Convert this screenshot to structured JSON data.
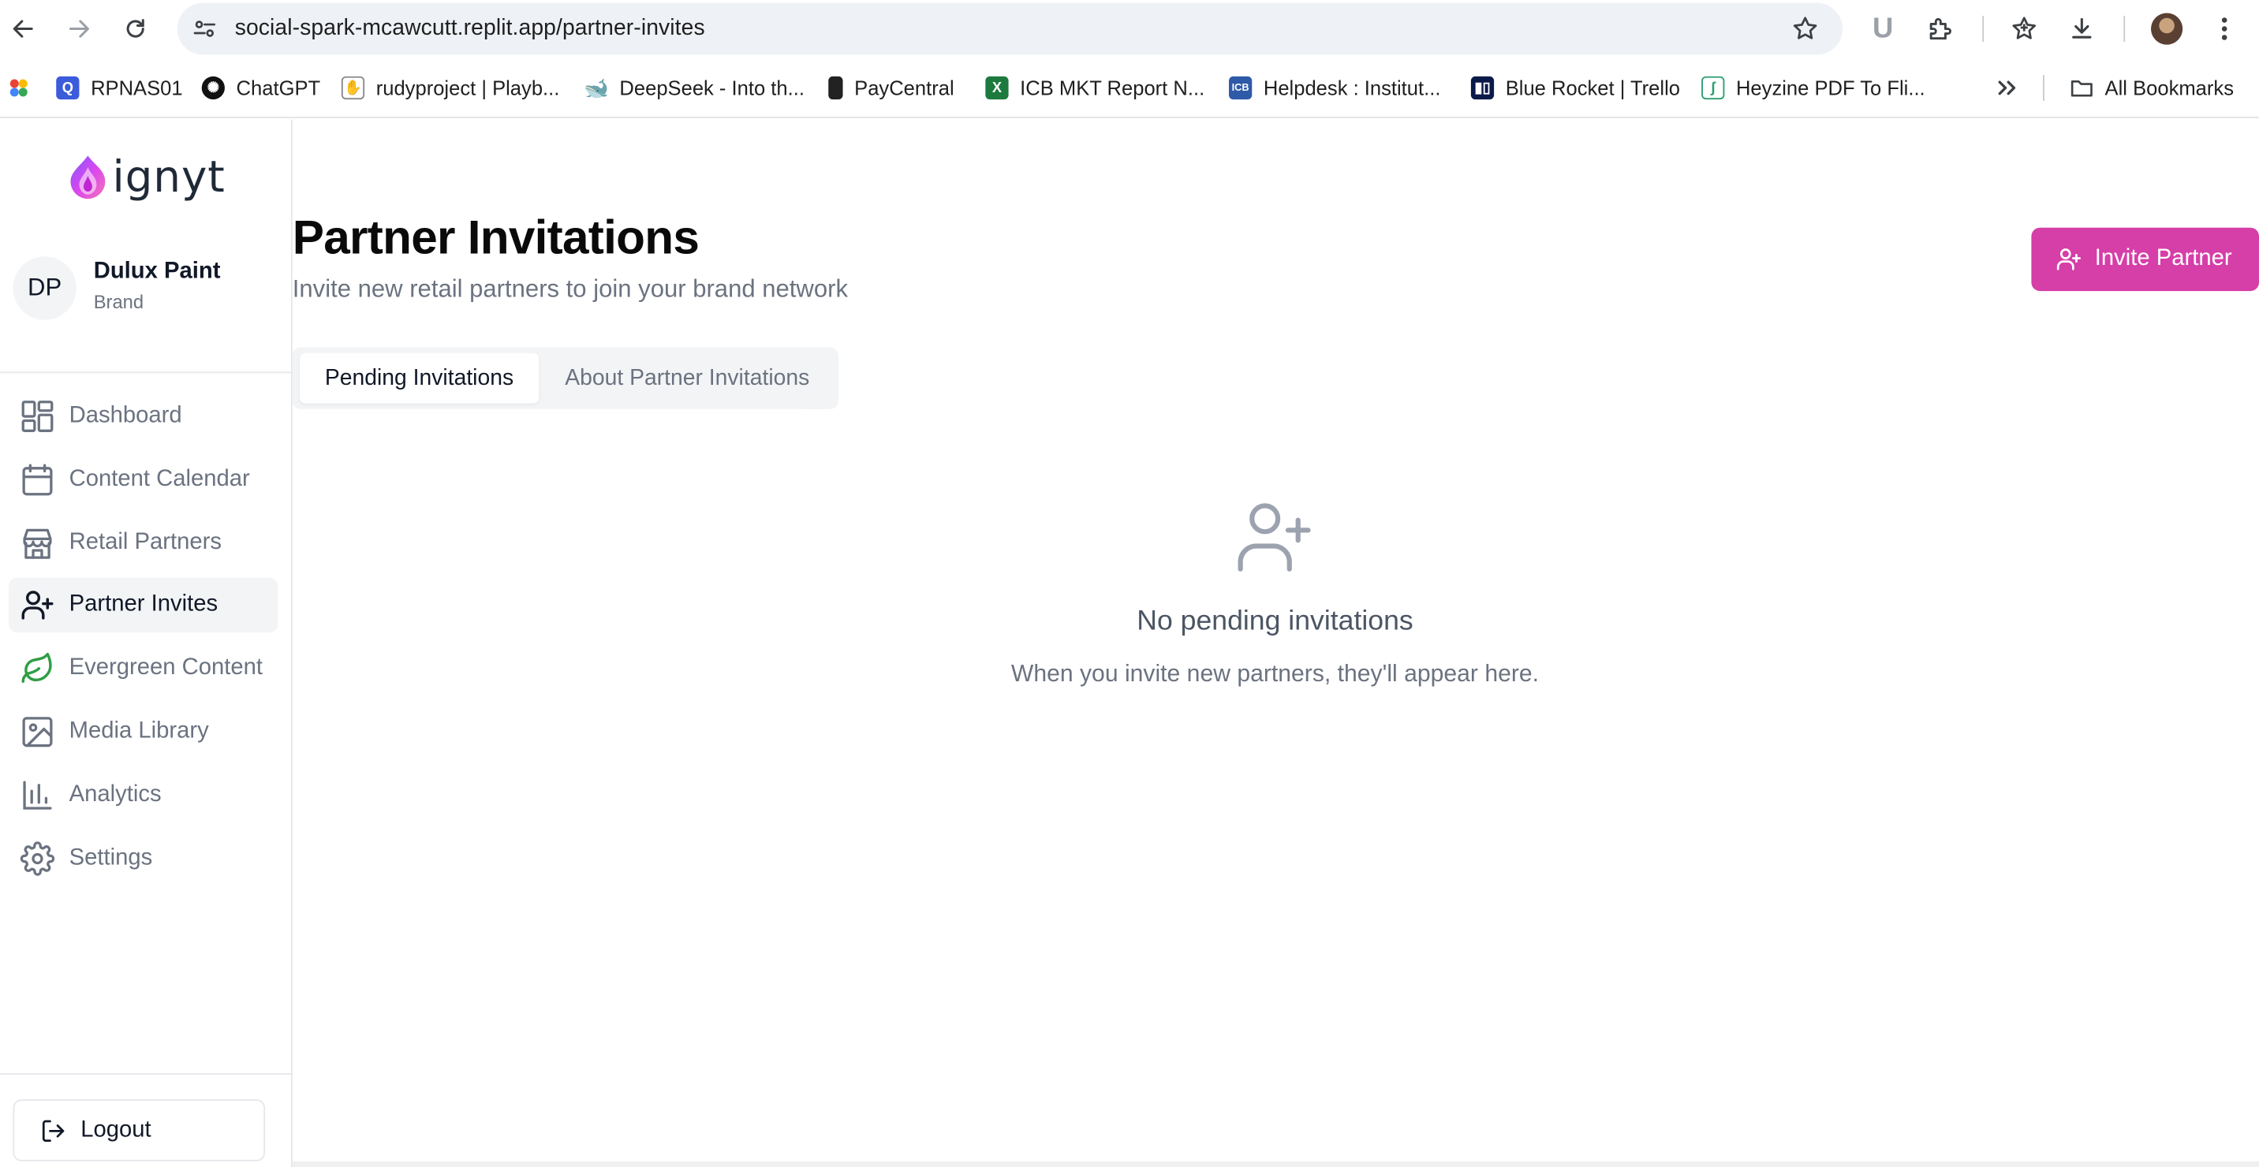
{
  "browser": {
    "url_host": "social-spark-mcawcutt.replit.app",
    "url_path": "/partner-invites"
  },
  "bookmarks": [
    {
      "label": "RPNAS01",
      "color": "#3b5bdb"
    },
    {
      "label": "ChatGPT",
      "color": "#111111"
    },
    {
      "label": "rudyproject | Playb...",
      "color": "#555555"
    },
    {
      "label": "DeepSeek - Into th...",
      "color": "#4d6bfe"
    },
    {
      "label": "PayCentral",
      "color": "#222222"
    },
    {
      "label": "ICB MKT Report N...",
      "color": "#1d7a3e"
    },
    {
      "label": "Helpdesk : Institut...",
      "color": "#2e5aa8"
    },
    {
      "label": "Blue Rocket | Trello",
      "color": "#0c1a4a"
    },
    {
      "label": "Heyzine PDF To Fli...",
      "color": "#2a9d6e"
    }
  ],
  "all_bookmarks_label": "All Bookmarks",
  "brand": {
    "name": "ignyt"
  },
  "user": {
    "initials": "DP",
    "name": "Dulux Paint",
    "role": "Brand"
  },
  "nav": [
    {
      "label": "Dashboard",
      "icon": "layout-grid-icon"
    },
    {
      "label": "Content Calendar",
      "icon": "calendar-icon"
    },
    {
      "label": "Retail Partners",
      "icon": "store-icon"
    },
    {
      "label": "Partner Invites",
      "icon": "user-plus-icon",
      "active": true
    },
    {
      "label": "Evergreen Content",
      "icon": "leaf-icon"
    },
    {
      "label": "Media Library",
      "icon": "image-icon"
    },
    {
      "label": "Analytics",
      "icon": "bar-chart-icon"
    },
    {
      "label": "Settings",
      "icon": "gear-icon"
    }
  ],
  "logout_label": "Logout",
  "page": {
    "title": "Partner Invitations",
    "subtitle": "Invite new retail partners to join your brand network",
    "invite_button": "Invite Partner",
    "tabs": [
      "Pending Invitations",
      "About Partner Invitations"
    ],
    "empty_title": "No pending invitations",
    "empty_text": "When you invite new partners, they'll appear here."
  },
  "colors": {
    "accent": "#d63ea8",
    "evergreen_icon": "#2f9e44"
  }
}
